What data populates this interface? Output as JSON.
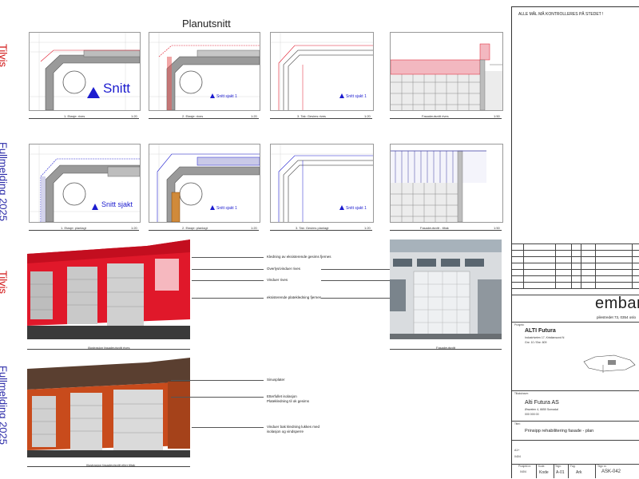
{
  "header": {
    "title": "Planutsnitt"
  },
  "side_labels": {
    "row1": "Tilvis",
    "row2": "Fullmelding 2025",
    "row3": "Tilvis",
    "row4": "Fullmelding 2025"
  },
  "panels_row1": [
    {
      "caption": "1. Etasje: rives",
      "scale": "1:20",
      "label": "Snitt"
    },
    {
      "caption": "2. Etasje: rives",
      "scale": "1:20",
      "label": "Snitt sjakt 1"
    },
    {
      "caption": "3. Tak: Gesims rives",
      "scale": "1:20",
      "label": "Snitt sjakt 1"
    },
    {
      "caption": "Fasadeutsnitt rives",
      "scale": "1:50"
    }
  ],
  "panels_row2": [
    {
      "caption": "1. Etasje: planlagt",
      "scale": "1:20",
      "label": "Snitt sjakt"
    },
    {
      "caption": "2. Etasje: planlagt",
      "scale": "1:20",
      "label": "Snitt sjakt 1"
    },
    {
      "caption": "3. Tak: Gesims planlagt",
      "scale": "1:20",
      "label": "Snitt sjakt 1"
    },
    {
      "caption": "Fasadeutsnitt - tiltak",
      "scale": "1:50"
    }
  ],
  "render_row3": {
    "caption_left": "Illustrasjon fasadeutsnitt rives",
    "caption_right": "Fasadeutsnitt",
    "annotations": [
      "Kledning av eksisterende gesims fjernes",
      "Overlys/vinduer rives",
      "Vinduer rives",
      "eksisterende platekledning fjernes"
    ]
  },
  "render_row4": {
    "caption": "Illustrasjon fasadeutsnitt etter tiltak",
    "annotations": [
      "Sinusplater",
      "Etterfullet isolasjon Platekledning til ok gesims",
      "Vinduer bak kledning lukkes med isolasjon og vindsperre"
    ]
  },
  "titleblock": {
    "notice": "ALLE MÅL MÅ KONTROLLERES PÅ STEDET !",
    "logo": "embark",
    "address": "pilestredet 73, 0354 oslo",
    "project_label": "Prosjekt:",
    "project_name": "ALTI Futura",
    "project_address": "Industriveien 17, Kristiansund N",
    "project_gnr": "Gnr. 10 / Bnr. 609",
    "client_label": "Tiltakshaver:",
    "client_name": "Alti Futura AS",
    "client_address": "Øraveien 4, 6650 Surnadal",
    "client_org": "000 000 00",
    "title_label": "Tittel:",
    "drawing_title": "Prinsipp rehabilitering fasade - plan",
    "project_no": "0404",
    "code": "Kode",
    "sheet": "A-01",
    "discipline": "Ark",
    "drawing_no": "ASK-042",
    "scale": "A1+",
    "scale_value": "0404",
    "labels": {
      "project_no": "Prosjekt nr:",
      "code": "Kode:",
      "sheet": "Tegn:",
      "discipline": "Fag:",
      "drawing_no": "Tegn nr:"
    }
  },
  "colors": {
    "red": "#e0182a",
    "blue": "#1c1ccf",
    "grid": "#c9c9c9"
  }
}
